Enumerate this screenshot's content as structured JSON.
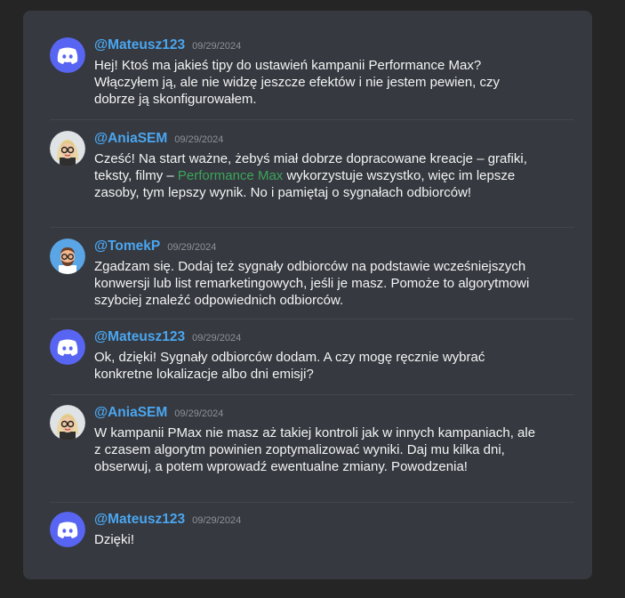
{
  "messages": [
    {
      "user": "@Mateusz123",
      "time": "09/29/2024",
      "avatar": "discord-logo-icon",
      "text": "Hej! Ktoś ma jakieś tipy do ustawień kampanii Performance Max? Włączyłem ją, ale nie widzę jeszcze efektów i nie jestem pewien, czy dobrze ją skonfigurowałem."
    },
    {
      "user": "@AniaSEM",
      "time": "09/29/2024",
      "avatar": "woman-avatar-icon",
      "text_before": "Cześć! Na start ważne, żebyś miał dobrze dopracowane kreacje – grafiki, teksty, filmy – ",
      "highlight": "Performance Max",
      "text_after": " wykorzystuje wszystko, więc im lepsze zasoby, tym lepszy wynik. No i pamiętaj o sygnałach odbiorców!"
    },
    {
      "user": "@TomekP",
      "time": "09/29/2024",
      "avatar": "man-avatar-icon",
      "text": "Zgadzam się. Dodaj też sygnały odbiorców na podstawie wcześniejszych konwersji lub list remarketingowych, jeśli je masz. Pomoże to algorytmowi szybciej znaleźć odpowiednich odbiorców."
    },
    {
      "user": "@Mateusz123",
      "time": "09/29/2024",
      "avatar": "discord-logo-icon",
      "text": "Ok, dzięki! Sygnały odbiorców dodam. A czy mogę ręcznie wybrać konkretne lokalizacje albo dni emisji?"
    },
    {
      "user": "@AniaSEM",
      "time": "09/29/2024",
      "avatar": "woman-avatar-icon",
      "text": "W kampanii PMax nie masz aż takiej kontroli jak w innych kampaniach, ale z czasem algorytm powinien zoptymalizować wyniki. Daj mu kilka dni, obserwuj, a potem wprowadź ewentualne zmiany. Powodzenia!"
    },
    {
      "user": "@Mateusz123",
      "time": "09/29/2024",
      "avatar": "discord-logo-icon",
      "text": "Dzięki!"
    }
  ],
  "colors": {
    "background": "#252525",
    "panel": "#36393f",
    "username": "#4aa6f0",
    "highlight": "#3ba55c",
    "discord_blurple": "#5865f2"
  }
}
